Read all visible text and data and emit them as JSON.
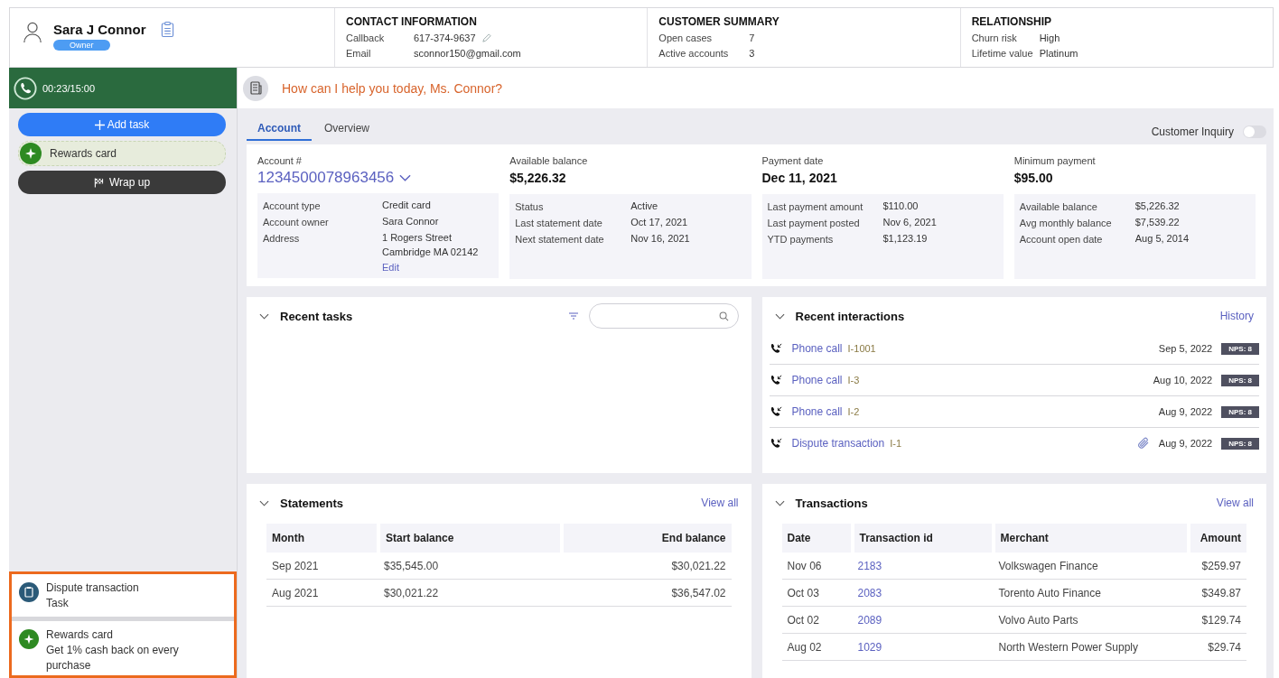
{
  "customer": {
    "name": "Sara J Connor",
    "badge": "Owner"
  },
  "summary_sections": [
    {
      "title": "CONTACT INFORMATION",
      "fields": [
        {
          "label": "Callback",
          "value": "617-374-9637",
          "editable": true
        },
        {
          "label": "Email",
          "value": "sconnor150@gmail.com",
          "editable": false
        }
      ]
    },
    {
      "title": "CUSTOMER SUMMARY",
      "fields": [
        {
          "label": "Open cases",
          "value": "7",
          "editable": false
        },
        {
          "label": "Active accounts",
          "value": "3",
          "editable": false
        }
      ]
    },
    {
      "title": "RELATIONSHIP",
      "fields": [
        {
          "label": "Churn risk",
          "value": "High",
          "editable": false
        },
        {
          "label": "Lifetime value",
          "value": "Platinum",
          "editable": false
        }
      ]
    }
  ],
  "sidebar": {
    "timer": "00:23/15:00",
    "add_task": "Add task",
    "suggestion": "Rewards card",
    "wrap_up": "Wrap up",
    "cards": [
      {
        "kind": "task",
        "title": "Dispute transaction",
        "subtitle": "Task"
      },
      {
        "kind": "offer",
        "title": "Rewards card",
        "subtitle": "Get 1% cash back on every purchase"
      }
    ]
  },
  "greeting": "How can I help you today, Ms. Connor?",
  "tabs": [
    {
      "label": "Account",
      "selected": true
    },
    {
      "label": "Overview",
      "selected": false
    }
  ],
  "toggle": {
    "label": "Customer Inquiry",
    "on": false
  },
  "account_columns": [
    {
      "label": "Account #",
      "value": "1234500078963456",
      "kind": "link",
      "details": [
        {
          "label": "Account type",
          "value": "Credit card"
        },
        {
          "label": "Account owner",
          "value": "Sara Connor"
        },
        {
          "label": "Address",
          "value": "1 Rogers Street\nCambridge  MA 02142",
          "action": "Edit"
        }
      ]
    },
    {
      "label": "Available balance",
      "value": "$5,226.32",
      "kind": "plain",
      "details": [
        {
          "label": "Status",
          "value": "Active"
        },
        {
          "label": "Last statement date",
          "value": "Oct 17, 2021"
        },
        {
          "label": "Next statement date",
          "value": "Nov 16, 2021"
        }
      ]
    },
    {
      "label": "Payment date",
      "value": "Dec 11, 2021",
      "kind": "plain",
      "details": [
        {
          "label": "Last payment amount",
          "value": "$110.00"
        },
        {
          "label": "Last payment posted",
          "value": "Nov 6, 2021"
        },
        {
          "label": "YTD payments",
          "value": "$1,123.19"
        }
      ]
    },
    {
      "label": "Minimum payment",
      "value": "$95.00",
      "kind": "plain",
      "details": [
        {
          "label": "Available balance",
          "value": "$5,226.32"
        },
        {
          "label": "Avg monthly balance",
          "value": "$7,539.22"
        },
        {
          "label": "Account open date",
          "value": "Aug 5, 2014"
        }
      ]
    }
  ],
  "recent_tasks": {
    "title": "Recent tasks"
  },
  "recent_interactions": {
    "title": "Recent interactions",
    "link": "History",
    "rows": [
      {
        "title": "Phone call",
        "id": "I-1001",
        "date": "Sep 5, 2022",
        "attachment": false,
        "badge": "NPS: 8"
      },
      {
        "title": "Phone call",
        "id": "I-3",
        "date": "Aug 10, 2022",
        "attachment": false,
        "badge": "NPS: 8"
      },
      {
        "title": "Phone call",
        "id": "I-2",
        "date": "Aug 9, 2022",
        "attachment": false,
        "badge": "NPS: 8"
      },
      {
        "title": "Dispute transaction",
        "id": "I-1",
        "date": "Aug 9, 2022",
        "attachment": true,
        "badge": "NPS: 8"
      }
    ]
  },
  "statements": {
    "title": "Statements",
    "link": "View all",
    "columns": [
      "Month",
      "Start balance",
      "End balance"
    ],
    "rows": [
      [
        "Sep 2021",
        "$35,545.00",
        "$30,021.22"
      ],
      [
        "Aug 2021",
        "$30,021.22",
        "$36,547.02"
      ]
    ]
  },
  "transactions": {
    "title": "Transactions",
    "link": "View all",
    "columns": [
      "Date",
      "Transaction id",
      "Merchant",
      "Amount"
    ],
    "rows": [
      [
        "Nov 06",
        "2183",
        "Volkswagen Finance",
        "$259.97"
      ],
      [
        "Oct 03",
        "2083",
        "Torento Auto Finance",
        "$349.87"
      ],
      [
        "Oct 02",
        "2089",
        "Volvo Auto Parts",
        "$129.74"
      ],
      [
        "Aug 02",
        "1029",
        "North Western Power Supply",
        "$29.74"
      ]
    ]
  }
}
